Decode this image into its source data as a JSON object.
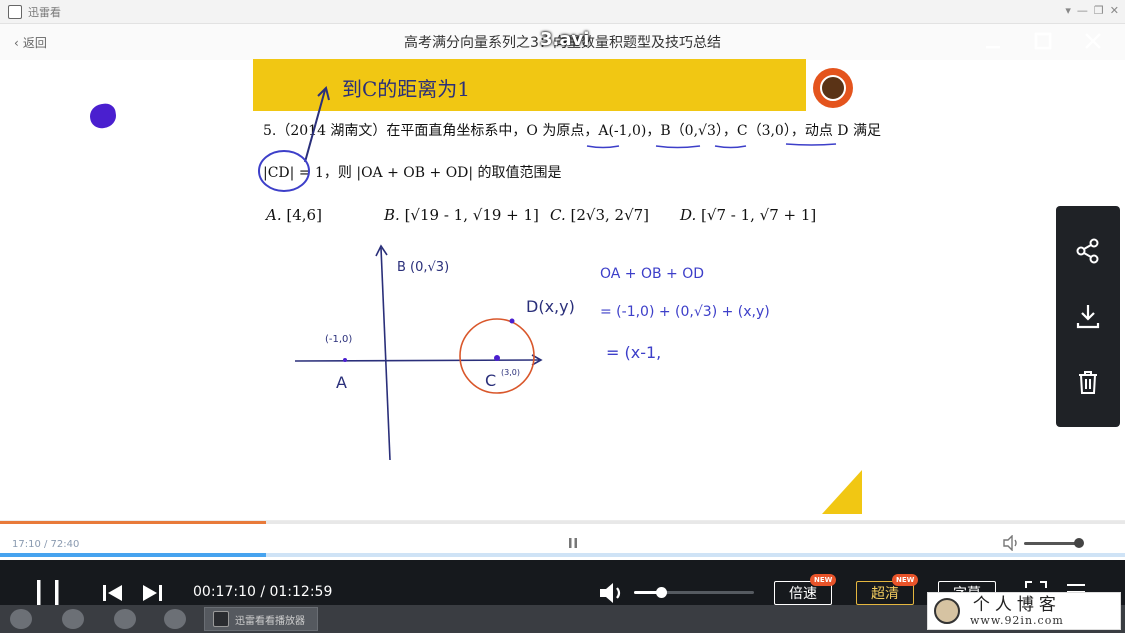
{
  "os_bar": {
    "app_title": "迅雷看"
  },
  "header": {
    "back_label": "返回",
    "title": "高考满分向量系列之3：向量数量积题型及技巧总结",
    "file_name": "3.avi"
  },
  "problem": {
    "line1": "5.（2014 湖南文）在平面直角坐标系中，O 为原点，A(-1,0)，B（0,√3），C（3,0），动点 D 满足",
    "line2": "|CD| = 1，则 |OA + OB + OD| 的取值范围是",
    "options": [
      {
        "key": "A.",
        "text": "[4,6]"
      },
      {
        "key": "B.",
        "text": "[√19 - 1, √19 + 1]"
      },
      {
        "key": "C.",
        "text": "[2√3, 2√7]"
      },
      {
        "key": "D.",
        "text": "[√7 - 1, √7 + 1]"
      }
    ]
  },
  "handwriting": {
    "banner_note": "到C的距离为1",
    "label_b": "B (0,√3)",
    "label_a_coord": "(-1,0)",
    "label_a": "A",
    "label_c": "C",
    "label_c_coord": "(3,0)",
    "label_d": "D(x,y)",
    "vec_line1": "OA + OB + OD",
    "vec_line2": "= (-1,0) + (0,√3) + (x,y)",
    "vec_line3": "= (x-1,"
  },
  "progress": {
    "time_label": "17:10 / 72:40",
    "played_fraction": 0.236,
    "buffered_fraction": 0.236,
    "mini_volume": 0.9
  },
  "controls": {
    "time_display": "00:17:10 / 01:12:59",
    "volume": 0.2,
    "speed_label": "倍速",
    "quality_label": "超清",
    "subtitle_label": "字幕",
    "new_badge": "NEW"
  },
  "taskbar": {
    "task_label": "迅雷看看播放器"
  },
  "watermark": {
    "title": "个人博客",
    "url": "www.92in.com"
  },
  "colors": {
    "banner": "#f1c713",
    "accent_orange": "#e87a3a",
    "accent_blue": "#46a3ef",
    "ink_purple": "#4a1fcf"
  }
}
